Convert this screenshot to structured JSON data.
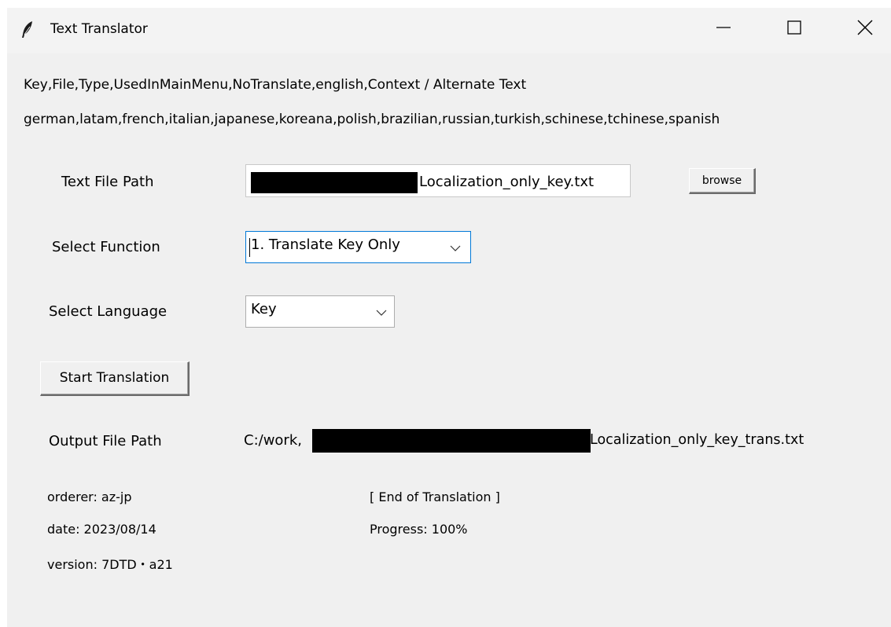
{
  "window": {
    "title": "Text Translator",
    "icons": {
      "app": "feather-icon",
      "minimize": "minimize-icon",
      "maximize": "maximize-icon",
      "close": "close-icon"
    }
  },
  "header": {
    "line1": "Key,File,Type,UsedInMainMenu,NoTranslate,english,Context / Alternate Text",
    "line2": "german,latam,french,italian,japanese,koreana,polish,brazilian,russian,turkish,schinese,tchinese,spanish"
  },
  "form": {
    "text_file_label": "Text File Path",
    "text_file_value": "Localization_only_key.txt",
    "browse_label": "browse",
    "function_label": "Select Function",
    "function_value": "1. Translate Key Only",
    "language_label": "Select Language",
    "language_value": "Key",
    "start_label": "Start Translation",
    "output_label": "Output File Path",
    "output_prefix": "C:/work,",
    "output_value": "Localization_only_key_trans.txt"
  },
  "info": {
    "orderer": "orderer: az-jp",
    "date": "date: 2023/08/14",
    "version": "version: 7DTD・a21"
  },
  "status": {
    "message": "[ End of Translation ]",
    "progress_text": "Progress: 100%",
    "progress": 1.0
  },
  "colors": {
    "window_bg": "#f0f0f0",
    "titlebar_bg": "#f3f3f3",
    "combo_focus": "#0078d7"
  }
}
